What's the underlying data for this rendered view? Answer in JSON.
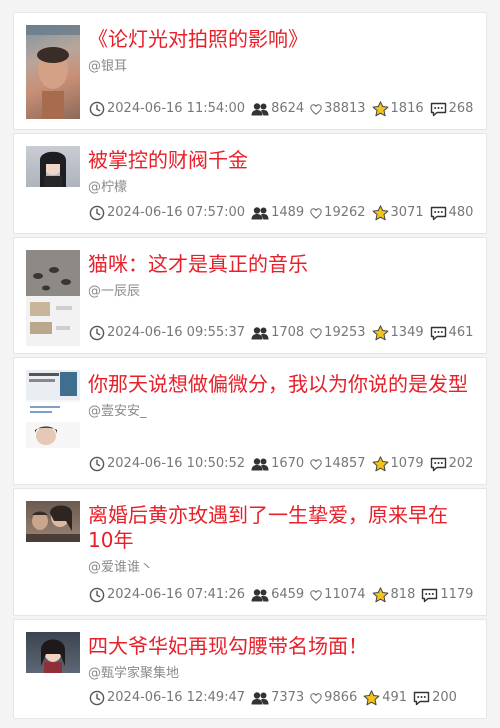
{
  "colors": {
    "title": "#e8202a",
    "meta": "#777777",
    "author": "#8a8a8a",
    "star": "#f2c418"
  },
  "icons": {
    "time": "clock-icon",
    "views": "viewers-icon",
    "likes": "heart-icon",
    "favorites": "star-icon",
    "comments": "comment-icon"
  },
  "videos": [
    {
      "title": "《论灯光对拍照的影响》",
      "author": "@银耳",
      "date": "2024-06-16 11:54:00",
      "views": "8624",
      "likes": "38813",
      "favorites": "1816",
      "comments": "268"
    },
    {
      "title": "被掌控的财阀千金",
      "author": "@柠檬",
      "date": "2024-06-16 07:57:00",
      "views": "1489",
      "likes": "19262",
      "favorites": "3071",
      "comments": "480"
    },
    {
      "title": "猫咪：这才是真正的音乐",
      "author": "@一辰辰",
      "date": "2024-06-16 09:55:37",
      "views": "1708",
      "likes": "19253",
      "favorites": "1349",
      "comments": "461"
    },
    {
      "title": "你那天说想做偏微分，我以为你说的是发型",
      "author": "@壹安安_",
      "date": "2024-06-16 10:50:52",
      "views": "1670",
      "likes": "14857",
      "favorites": "1079",
      "comments": "202"
    },
    {
      "title": "离婚后黄亦玫遇到了一生挚爱，原来早在10年",
      "author": "@爱谁谁丶",
      "date": "2024-06-16 07:41:26",
      "views": "6459",
      "likes": "11074",
      "favorites": "818",
      "comments": "1179"
    },
    {
      "title": "四大爷华妃再现勾腰带名场面！",
      "author": "@甄学家聚集地",
      "date": "2024-06-16 12:49:47",
      "views": "7373",
      "likes": "9866",
      "favorites": "491",
      "comments": "200"
    }
  ]
}
